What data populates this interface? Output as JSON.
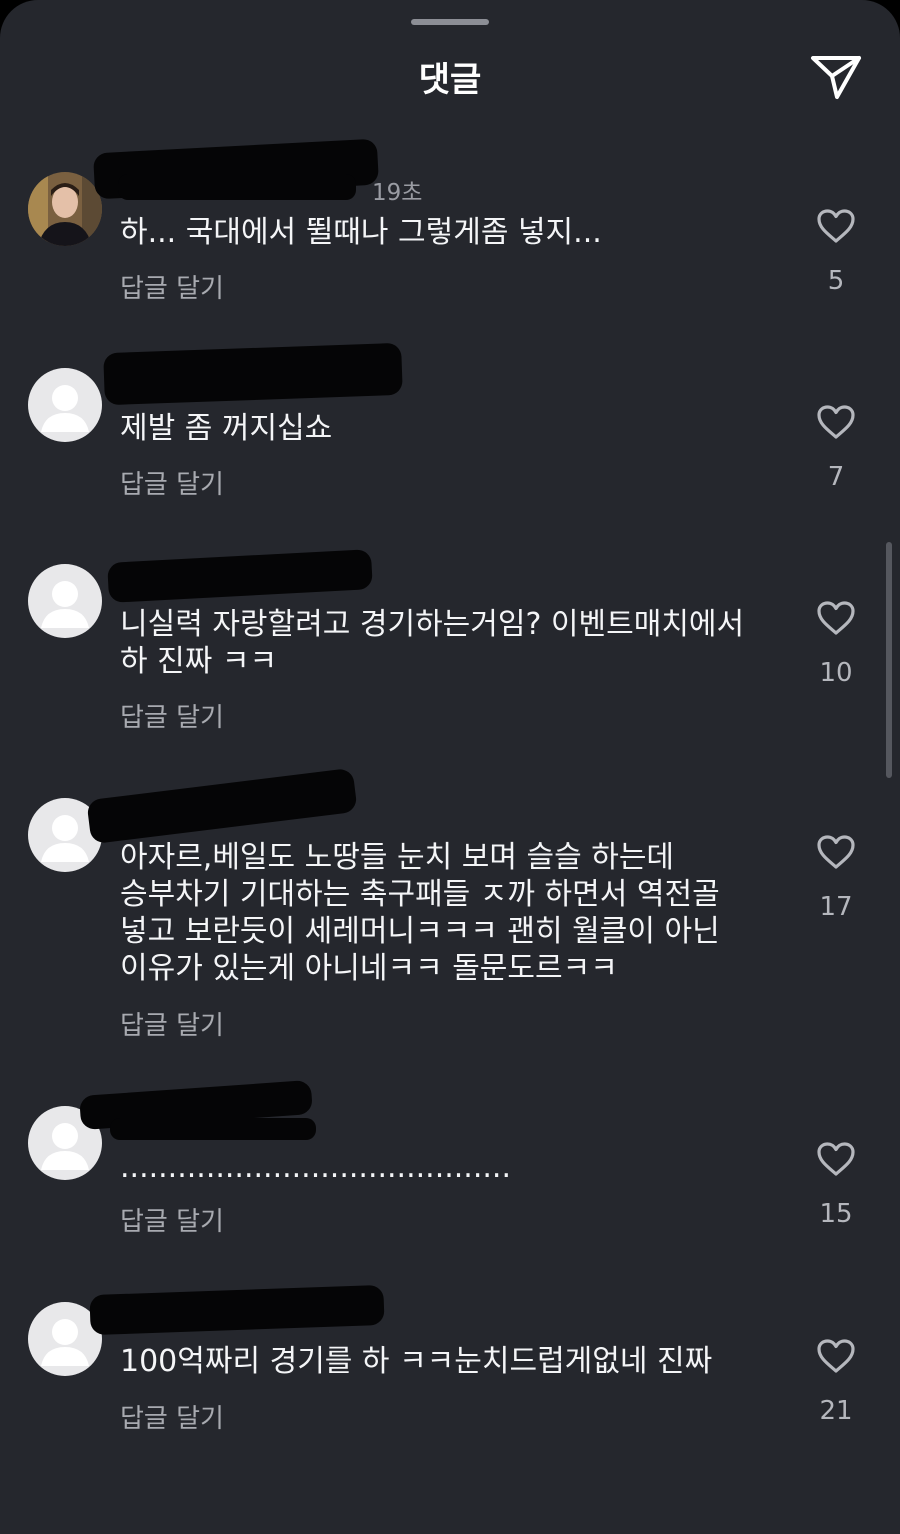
{
  "header": {
    "title": "댓글",
    "share_icon": "paper-plane-icon"
  },
  "comments": [
    {
      "meta": "19초",
      "text": "하... 국대에서 뛸때나 그렇게좀 넣지...",
      "reply_label": "답글 달기",
      "like_count": "5",
      "avatar": "photo"
    },
    {
      "meta": "",
      "text": "제발 좀 꺼지십쇼",
      "reply_label": "답글 달기",
      "like_count": "7",
      "avatar": "default"
    },
    {
      "meta": "",
      "text": "니실력 자랑할려고 경기하는거임? 이벤트매치에서 하 진짜 ㅋㅋ",
      "reply_label": "답글 달기",
      "like_count": "10",
      "avatar": "default"
    },
    {
      "meta": "",
      "text": "아자르,베일도 노땅들 눈치 보며 슬슬 하는데 승부차기 기대하는 축구패들 ㅈ까 하면서 역전골 넣고 보란듯이 세레머니ㅋㅋㅋ 괜히 월클이 아닌 이유가 있는게 아니네ㅋㅋ 돌문도르ㅋㅋ",
      "reply_label": "답글 달기",
      "like_count": "17",
      "avatar": "default"
    },
    {
      "meta": "",
      "text": ".........................................",
      "reply_label": "답글 달기",
      "like_count": "15",
      "avatar": "default"
    },
    {
      "meta": "",
      "text": "100억짜리 경기를 하 ㅋㅋ눈치드럽게없네 진짜",
      "reply_label": "답글 달기",
      "like_count": "21",
      "avatar": "default"
    }
  ],
  "colors": {
    "background": "#25272d",
    "text": "#f4f5f7",
    "secondary_text": "#a8aab0",
    "redaction": "#050506"
  }
}
